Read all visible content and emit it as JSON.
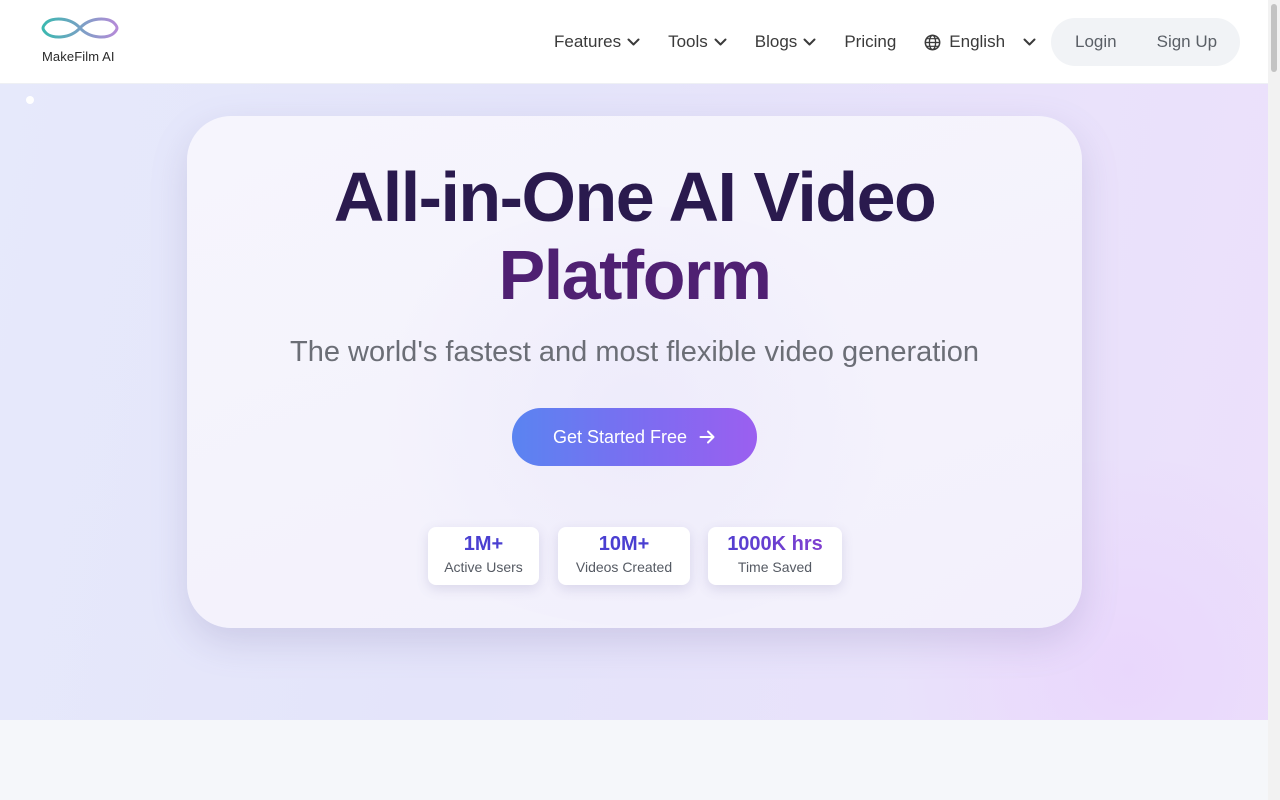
{
  "brand": {
    "name": "MakeFilm AI",
    "logo_icon": "infinity-logo-icon",
    "logo_colors": [
      "#3bb8b0",
      "#b58ad8"
    ]
  },
  "nav": {
    "items": [
      {
        "label": "Features",
        "icon": "chevron-down-icon"
      },
      {
        "label": "Tools",
        "icon": "chevron-down-icon"
      },
      {
        "label": "Blogs",
        "icon": "chevron-down-icon"
      },
      {
        "label": "Pricing"
      }
    ],
    "language": {
      "label": "English",
      "icon": "globe-icon"
    },
    "login_label": "Login",
    "signup_label": "Sign Up"
  },
  "hero": {
    "title_line1": "All-in-One AI Video",
    "title_line2": "Platform",
    "subtitle": "The world's fastest and most flexible video generation",
    "cta_label": "Get Started Free",
    "cta_icon": "arrow-right-icon",
    "stats": [
      {
        "value": "1M+",
        "label": "Active Users"
      },
      {
        "value": "10M+",
        "label": "Videos Created"
      },
      {
        "value": "1000K hrs",
        "label": "Time Saved"
      }
    ]
  },
  "colors": {
    "title_dark": "#2a1a4e",
    "title_purple": "#4f2072",
    "cta_gradient_start": "#5a84f1",
    "cta_gradient_end": "#9b5ff0",
    "stat_value": "#4a3fd1"
  }
}
